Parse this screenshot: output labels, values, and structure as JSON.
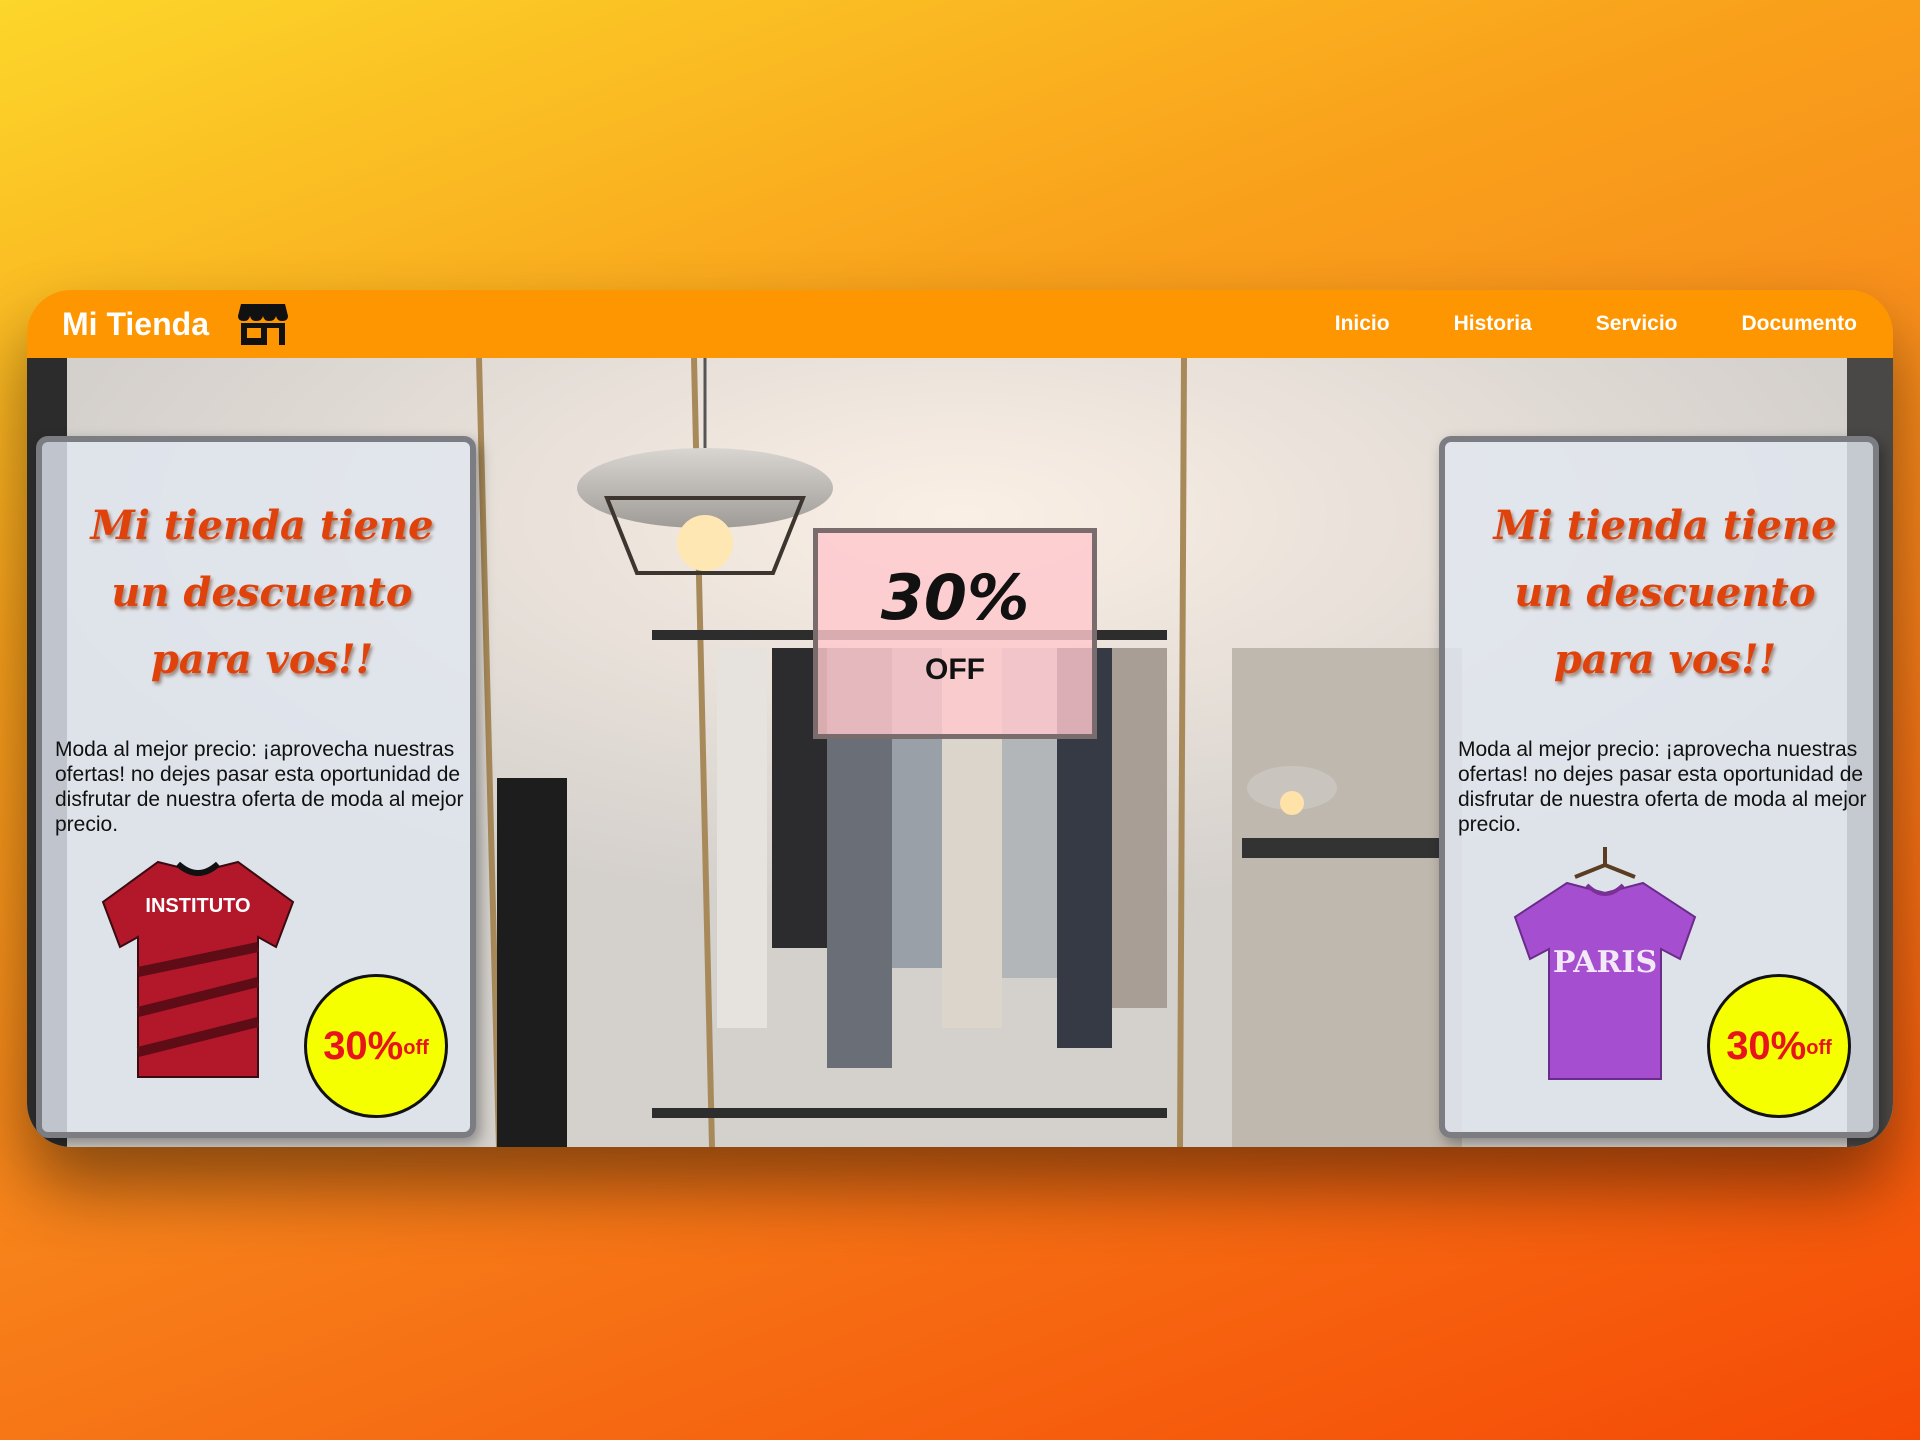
{
  "navbar": {
    "brand": "Mi Tienda",
    "brand_icon": "store-icon",
    "links": [
      "Inicio",
      "Historia",
      "Servicio",
      "Documento"
    ],
    "background_color": "#fe9602"
  },
  "promo": {
    "percent": "30%",
    "label": "OFF"
  },
  "cards": [
    {
      "title": "Mi tienda tiene un descuento para vos!!",
      "description": "Moda al mejor precio: ¡aprovecha nuestras ofertas! no dejes pasar esta oportunidad de disfrutar de nuestra oferta de moda al mejor precio.",
      "product_image": "red-jersey-image",
      "product_text": "INSTITUTO",
      "badge_percent": "30%",
      "badge_off": "off"
    },
    {
      "title": "Mi tienda tiene un descuento para vos!!",
      "description": "Moda al mejor precio: ¡aprovecha nuestras ofertas! no dejes pasar esta oportunidad de disfrutar de nuestra oferta de moda al mejor precio.",
      "product_image": "purple-tshirt-image",
      "product_text": "PARIS",
      "badge_percent": "30%",
      "badge_off": "off"
    }
  ],
  "colors": {
    "title": "#e0420c",
    "badge_fill": "#f6ff00",
    "badge_text": "#e8141b"
  }
}
